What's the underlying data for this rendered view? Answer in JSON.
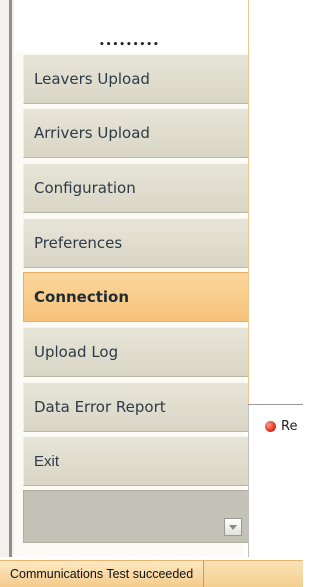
{
  "logo": {
    "text": "•••••••••"
  },
  "nav": {
    "items": [
      {
        "label": "Leavers Upload"
      },
      {
        "label": "Arrivers Upload"
      },
      {
        "label": "Configuration"
      },
      {
        "label": "Preferences"
      },
      {
        "label": "Connection",
        "active": true
      },
      {
        "label": "Upload Log"
      },
      {
        "label": "Data Error Report"
      },
      {
        "label": "Exit"
      }
    ]
  },
  "status_pane": {
    "text": "Re"
  },
  "statusbar": {
    "message": "Communications Test  succeeded"
  },
  "colors": {
    "active": "#f6c27c",
    "button": "#dedbcc",
    "status_bar": "#f7d9a4",
    "error_dot": "#e0321f"
  }
}
